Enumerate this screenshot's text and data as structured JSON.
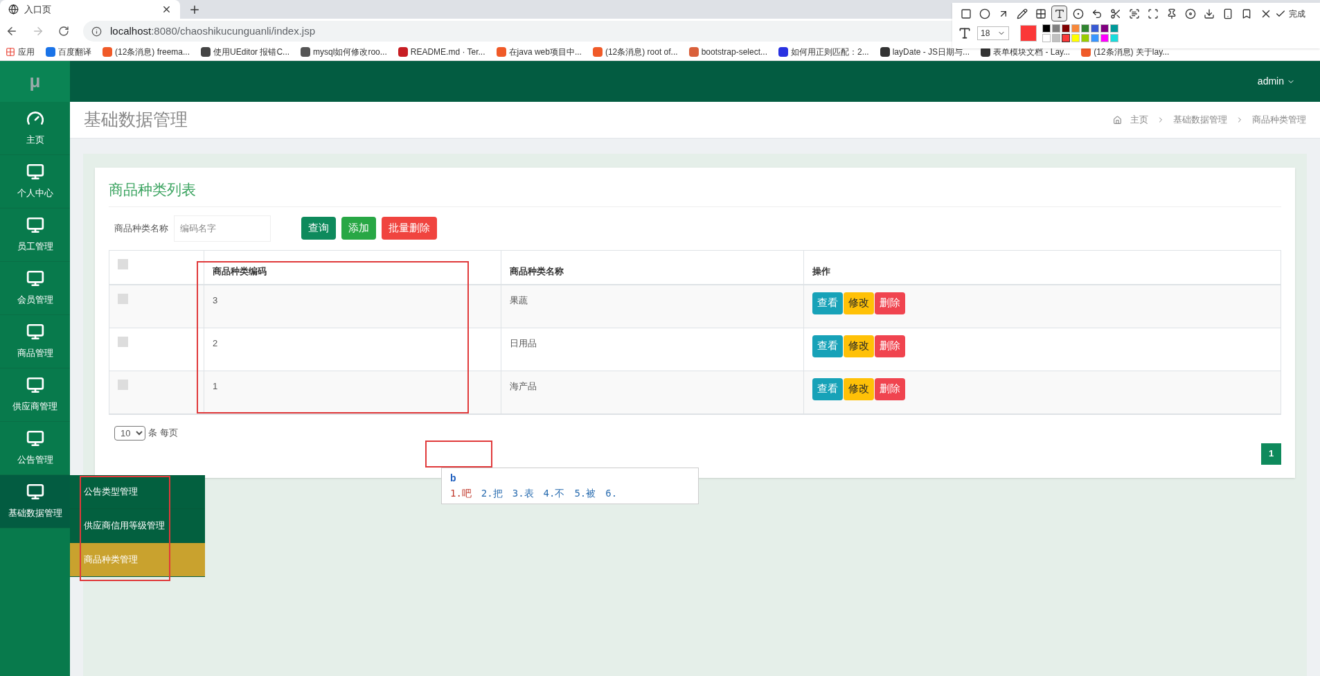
{
  "browser": {
    "tab_title": "入口页",
    "url_host": "localhost",
    "url_rest": ":8080/chaoshikucunguanli/index.jsp",
    "apps_label": "应用",
    "bookmarks": [
      {
        "label": "百度翻译",
        "color": "#1a73e8"
      },
      {
        "label": "(12条消息) freema...",
        "color": "#f05a28"
      },
      {
        "label": "使用UEditor 报错C...",
        "color": "#444444"
      },
      {
        "label": "mysql如何修改roo...",
        "color": "#555555"
      },
      {
        "label": "README.md · Ter...",
        "color": "#c71d23"
      },
      {
        "label": "在java web项目中...",
        "color": "#f05a28"
      },
      {
        "label": "(12条消息) root of...",
        "color": "#f05a28"
      },
      {
        "label": "bootstrap-select...",
        "color": "#d9603b"
      },
      {
        "label": "如何用正则匹配：2...",
        "color": "#2932e1"
      },
      {
        "label": "layDate - JS日期与...",
        "color": "#333333"
      },
      {
        "label": "表单模块文档 - Lay...",
        "color": "#333333"
      },
      {
        "label": "(12条消息) 关于lay...",
        "color": "#f05a28"
      }
    ]
  },
  "annotation_toolbar": {
    "tools": [
      {
        "kind": "rectangle",
        "selected": false
      },
      {
        "kind": "ellipse",
        "selected": false
      },
      {
        "kind": "arrow",
        "selected": false
      },
      {
        "kind": "pencil",
        "selected": false
      },
      {
        "kind": "mosaic",
        "selected": false
      },
      {
        "kind": "text",
        "selected": true
      },
      {
        "kind": "number",
        "selected": false
      },
      {
        "kind": "undo",
        "selected": false
      },
      {
        "kind": "cut",
        "selected": false
      },
      {
        "kind": "ocr",
        "selected": false
      },
      {
        "kind": "scan",
        "selected": false
      },
      {
        "kind": "pin",
        "selected": false
      },
      {
        "kind": "record",
        "selected": false
      },
      {
        "kind": "download",
        "selected": false
      },
      {
        "kind": "phone",
        "selected": false
      },
      {
        "kind": "bookmark",
        "selected": false
      }
    ],
    "done_label": "完成",
    "font_size": "18",
    "palette": [
      {
        "color": "#000000",
        "selected": false
      },
      {
        "color": "#808080",
        "selected": false
      },
      {
        "color": "#800000",
        "selected": false
      },
      {
        "color": "#f7883a",
        "selected": false
      },
      {
        "color": "#308430",
        "selected": false
      },
      {
        "color": "#385ad3",
        "selected": false
      },
      {
        "color": "#800080",
        "selected": false
      },
      {
        "color": "#009999",
        "selected": false
      },
      {
        "color": "#ffffff",
        "selected": false
      },
      {
        "color": "#c0c0c0",
        "selected": false
      },
      {
        "color": "#fb3838",
        "selected": true
      },
      {
        "color": "#ffff00",
        "selected": false
      },
      {
        "color": "#99cc00",
        "selected": false
      },
      {
        "color": "#3895ff",
        "selected": false
      },
      {
        "color": "#ff00ff",
        "selected": false
      },
      {
        "color": "#1adcdc",
        "selected": false
      }
    ]
  },
  "app": {
    "logo": "μ",
    "user": "admin",
    "sidebar": [
      {
        "label": "主页",
        "kind": "dashboard",
        "selected": false
      },
      {
        "label": "个人中心",
        "kind": "monitor",
        "selected": false
      },
      {
        "label": "员工管理",
        "kind": "monitor",
        "selected": false
      },
      {
        "label": "会员管理",
        "kind": "monitor",
        "selected": false
      },
      {
        "label": "商品管理",
        "kind": "monitor",
        "selected": false
      },
      {
        "label": "供应商管理",
        "kind": "monitor",
        "selected": false
      },
      {
        "label": "公告管理",
        "kind": "monitor",
        "selected": false
      },
      {
        "label": "基础数据管理",
        "kind": "monitor",
        "selected": true
      }
    ],
    "submenu": [
      {
        "label": "公告类型管理",
        "selected": false
      },
      {
        "label": "供应商信用等级管理",
        "selected": false
      },
      {
        "label": "商品种类管理",
        "selected": true
      }
    ],
    "page_title": "基础数据管理",
    "breadcrumb": [
      "主页",
      "基础数据管理",
      "商品种类管理"
    ],
    "card_title": "商品种类列表",
    "search": {
      "label": "商品种类名称",
      "placeholder": "编码名字"
    },
    "buttons": [
      {
        "label": "查询",
        "kind": "search"
      },
      {
        "label": "添加",
        "kind": "add"
      },
      {
        "label": "批量删除",
        "kind": "delete"
      }
    ],
    "table": {
      "header_checked": false,
      "columns": [
        "商品种类编码",
        "商品种类名称",
        "操作"
      ],
      "rows": [
        {
          "checked": false,
          "code": "3",
          "name": "果蔬",
          "actions": [
            {
              "label": "查看",
              "kind": "view"
            },
            {
              "label": "修改",
              "kind": "edit"
            },
            {
              "label": "删除",
              "kind": "delete"
            }
          ]
        },
        {
          "checked": false,
          "code": "2",
          "name": "日用品",
          "actions": [
            {
              "label": "查看",
              "kind": "view"
            },
            {
              "label": "修改",
              "kind": "edit"
            },
            {
              "label": "删除",
              "kind": "delete"
            }
          ]
        },
        {
          "checked": false,
          "code": "1",
          "name": "海产品",
          "actions": [
            {
              "label": "查看",
              "kind": "view"
            },
            {
              "label": "修改",
              "kind": "edit"
            },
            {
              "label": "删除",
              "kind": "delete"
            }
          ]
        }
      ]
    },
    "page_size": "10",
    "page_size_suffix": "条 每页",
    "pages": [
      {
        "label": "1",
        "selected": true
      }
    ]
  },
  "ime": {
    "input": "b",
    "candidates": [
      "1.吧",
      "2.把",
      "3.表",
      "4.不",
      "5.被",
      "6."
    ]
  }
}
